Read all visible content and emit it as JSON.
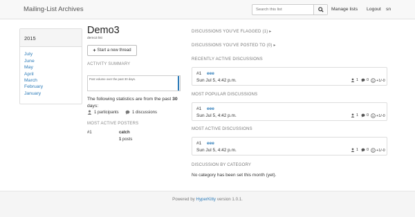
{
  "header": {
    "brand": "Mailing-List Archives",
    "search_placeholder": "Search this list",
    "manage_lists": "Manage lists",
    "logout": "Logout",
    "user": "sn"
  },
  "sidebar": {
    "year": "2015",
    "months": [
      "July",
      "June",
      "May",
      "April",
      "March",
      "February",
      "January"
    ]
  },
  "list": {
    "title": "Demo3",
    "subtitle": "demo3 list",
    "new_thread_label": "Start a new thread"
  },
  "activity": {
    "section_title": "ACTIVITY SUMMARY",
    "chart_caption": "Post volume over the past 30 days.",
    "chart_data": {
      "type": "bar",
      "values": [
        0,
        0,
        0,
        0,
        0,
        0,
        0,
        0,
        0,
        0,
        0,
        0,
        0,
        0,
        0,
        0,
        0,
        0,
        0,
        0,
        0,
        0,
        0,
        0,
        0,
        0,
        0,
        0,
        0,
        1
      ]
    },
    "stats_prefix": "The following statistics are from the past ",
    "stats_days": "30",
    "stats_suffix": " days:",
    "participants": "1 participants",
    "discussions": "1 discussions"
  },
  "posters": {
    "section_title": "MOST ACTIVE POSTERS",
    "items": [
      {
        "rank": "#1",
        "name": "catch",
        "posts_count": "1",
        "posts_label": " posts"
      }
    ]
  },
  "right": {
    "flagged": "DISCUSSIONS YOU'VE FLAGGED (1)",
    "posted": "DISCUSSIONS YOU'VE POSTED TO (0)",
    "recently_active_title": "RECENTLY ACTIVE DISCUSSIONS",
    "most_popular_title": "MOST POPULAR DISCUSSIONS",
    "most_active_title": "MOST ACTIVE DISCUSSIONS",
    "by_category_title": "DISCUSSION BY CATEGORY",
    "no_category": "No category has been set this month (yet)."
  },
  "thread": {
    "number": "#1",
    "subject": "eee",
    "date": "Sun Jul 5, 4:42 p.m.",
    "participants": "1",
    "replies": "0",
    "votes": "+1/-0"
  },
  "footer": {
    "prefix": "Powered by ",
    "product": "HyperKitty",
    "suffix": " version 1.0.1."
  }
}
